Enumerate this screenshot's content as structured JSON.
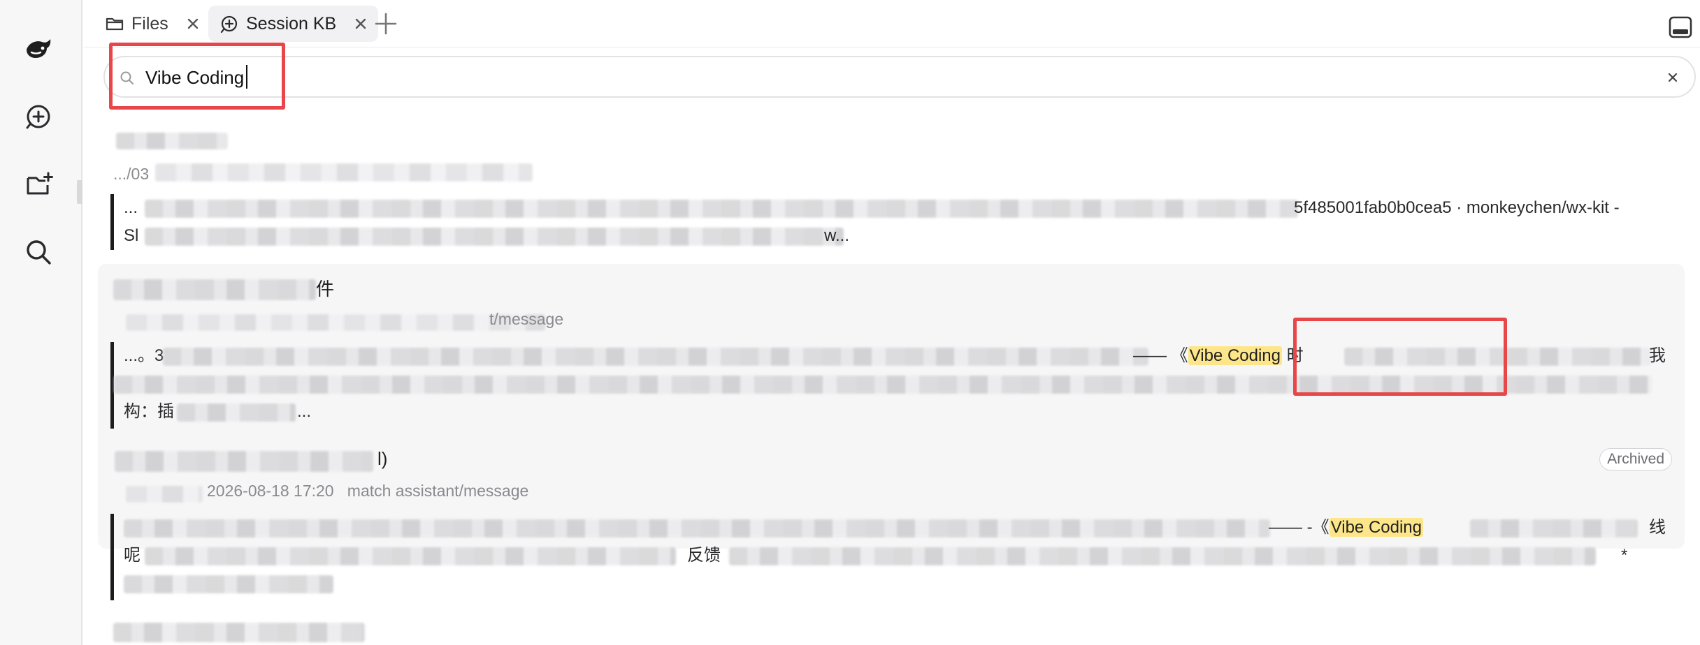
{
  "tabs": [
    {
      "label": "Files",
      "icon": "folder-icon",
      "active": false
    },
    {
      "label": "Session KB",
      "icon": "session-search-icon",
      "active": true
    }
  ],
  "search": {
    "value": "Vibe Coding",
    "placeholder": ""
  },
  "results": [
    {
      "meta": ".../03",
      "snippet_start": "...",
      "snippet_text_1": "5f485001fab0b0cea5 · monkeychen/wx-kit -",
      "snippet_line2_start": "Sl",
      "snippet_line2_end": "w..."
    },
    {
      "title_end": "件",
      "meta_end": "t/message",
      "snippet_start": "...。3",
      "snippet_before_mark": "—— 《",
      "mark": "Vibe Coding",
      "snippet_after_mark": "时",
      "snippet_line1_end": "我",
      "snippet_line3": "构：插",
      "snippet_line3_end": "..."
    },
    {
      "title_end": "l)",
      "badge": "Archived",
      "meta_date": "2026-08-18 17:20",
      "meta_match": "match assistant/message",
      "snippet_before_mark": "—— -《",
      "mark": "Vibe Coding",
      "snippet_line1_end": "线",
      "snippet_line2_start": "呢",
      "snippet_line2_mid": "反馈",
      "snippet_line2_end": "*"
    }
  ],
  "colors": {
    "highlight": "#fde68a",
    "annotation": "#e8474a",
    "accent_bar": "#1c1c1e"
  }
}
